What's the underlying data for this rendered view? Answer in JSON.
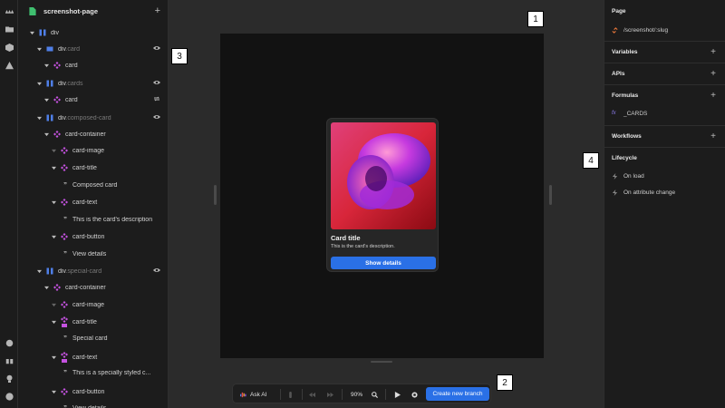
{
  "tree": {
    "page_title": "screenshot-page",
    "rows": [
      {
        "label": "div",
        "cls": ""
      },
      {
        "label": "div",
        "cls": ".card"
      },
      {
        "label": "card",
        "cls": ""
      },
      {
        "label": "div",
        "cls": ".cards"
      },
      {
        "label": "card",
        "cls": ""
      },
      {
        "label": "div",
        "cls": ".composed-card"
      },
      {
        "label": "card-container",
        "cls": ""
      },
      {
        "label": "card-image",
        "cls": ""
      },
      {
        "label": "card-title",
        "cls": ""
      },
      {
        "label": "Composed card",
        "cls": ""
      },
      {
        "label": "card-text",
        "cls": ""
      },
      {
        "label": "This is the card's description",
        "cls": ""
      },
      {
        "label": "card-button",
        "cls": ""
      },
      {
        "label": "View details",
        "cls": ""
      },
      {
        "label": "div",
        "cls": ".special-card"
      },
      {
        "label": "card-container",
        "cls": ""
      },
      {
        "label": "card-image",
        "cls": ""
      },
      {
        "label": "card-title",
        "cls": ""
      },
      {
        "label": "Special card",
        "cls": ""
      },
      {
        "label": "card-text",
        "cls": ""
      },
      {
        "label": "This is a specially styled c...",
        "cls": ""
      },
      {
        "label": "card-button",
        "cls": ""
      },
      {
        "label": "View details",
        "cls": ""
      }
    ]
  },
  "card": {
    "title": "Card title",
    "text": "This is the card's description.",
    "button": "Show details"
  },
  "badges": {
    "b1": "1",
    "b2": "2",
    "b3": "3",
    "b4": "4"
  },
  "toolbar": {
    "ask_ai": "Ask AI",
    "zoom": "90%",
    "create_branch": "Create new branch"
  },
  "right_panel": {
    "page_label": "Page",
    "page_slug": "/screenshot/:slug",
    "variables": "Variables",
    "apis": "APIs",
    "formulas": "Formulas",
    "formula_item": "_CARDS",
    "formula_fx": "fx",
    "workflows": "Workflows",
    "lifecycle": "Lifecycle",
    "on_load": "On load",
    "on_attr_change": "On attribute change"
  },
  "colors": {
    "accent": "#2a70e6",
    "component": "#c552e0",
    "element": "#4f7fe8",
    "page": "#3fbf6f"
  }
}
